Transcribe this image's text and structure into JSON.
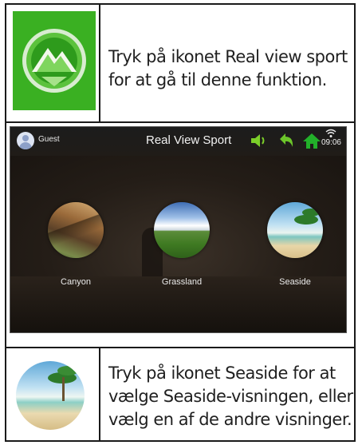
{
  "rows": [
    {
      "text_lines": [
        "Tryk på ikonet Real view sport",
        "for at gå til denne funktion."
      ]
    },
    {
      "text_lines": [
        "Tryk på ikonet Seaside for at",
        "vælge Seaside-visningen, eller",
        "vælg en af de andre visninger."
      ]
    }
  ],
  "screen": {
    "user": "Guest",
    "title": "Real View Sport",
    "clock": "09:06",
    "icons": [
      "volume-icon",
      "back-icon",
      "home-icon",
      "wifi-icon"
    ],
    "views": [
      {
        "label": "Canyon"
      },
      {
        "label": "Grassland"
      },
      {
        "label": "Seaside"
      }
    ]
  },
  "colors": {
    "icon_green": "#2ea31f",
    "volume_green": "#7ccf2a",
    "back_green": "#6cc52a",
    "home_green": "#22b02a",
    "border": "#1a1a1a"
  }
}
